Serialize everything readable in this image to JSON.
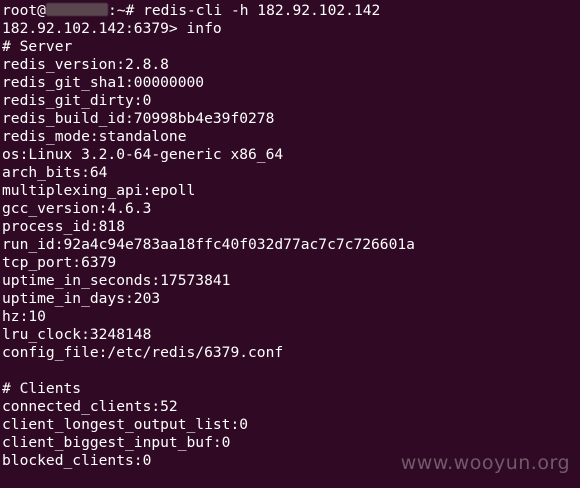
{
  "terminal": {
    "prompt_lines": [
      {
        "prefix": "root@",
        "redacted_width_chars": 7,
        "suffix": ":~# redis-cli -h 182.92.102.142"
      },
      {
        "text": "182.92.102.142:6379> info"
      }
    ],
    "output_lines": [
      "# Server",
      "redis_version:2.8.8",
      "redis_git_sha1:00000000",
      "redis_git_dirty:0",
      "redis_build_id:70998bb4e39f0278",
      "redis_mode:standalone",
      "os:Linux 3.2.0-64-generic x86_64",
      "arch_bits:64",
      "multiplexing_api:epoll",
      "gcc_version:4.6.3",
      "process_id:818",
      "run_id:92a4c94e783aa18ffc40f032d77ac7c7c726601a",
      "tcp_port:6379",
      "uptime_in_seconds:17573841",
      "uptime_in_days:203",
      "hz:10",
      "lru_clock:3248148",
      "config_file:/etc/redis/6379.conf",
      "",
      "# Clients",
      "connected_clients:52",
      "client_longest_output_list:0",
      "client_biggest_input_buf:0",
      "blocked_clients:0"
    ],
    "colors": {
      "background": "#300a24",
      "text": "#ffffff",
      "watermark": "#7a6272"
    }
  },
  "watermark": {
    "text": "www.wooyun.org"
  }
}
